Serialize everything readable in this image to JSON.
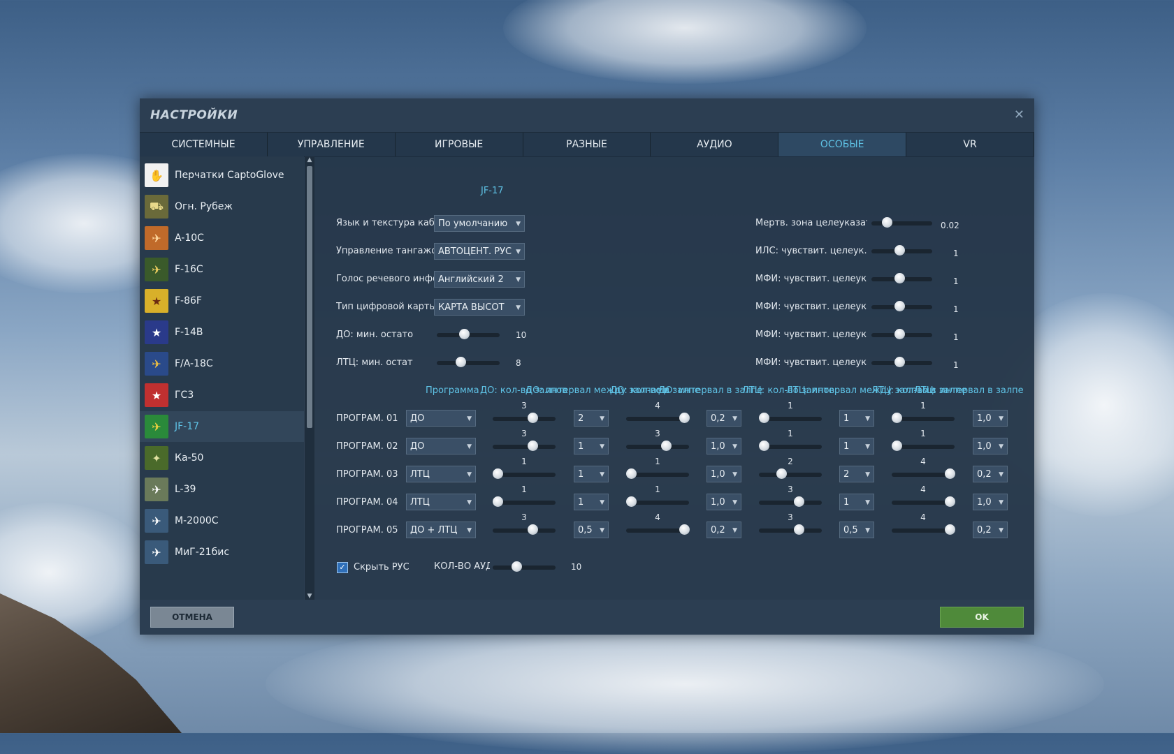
{
  "window": {
    "title": "НАСТРОЙКИ",
    "close_icon": "close-icon"
  },
  "tabs": [
    {
      "label": "СИСТЕМНЫЕ"
    },
    {
      "label": "УПРАВЛЕНИЕ"
    },
    {
      "label": "ИГРОВЫЕ"
    },
    {
      "label": "РАЗНЫЕ"
    },
    {
      "label": "АУДИО"
    },
    {
      "label": "ОСОБЫЕ",
      "active": true
    },
    {
      "label": "VR"
    }
  ],
  "sidebar": {
    "items": [
      {
        "label": "Перчатки CaptoGlove",
        "icon": "glove-icon"
      },
      {
        "label": "Огн. Рубеж",
        "icon": "tank-icon"
      },
      {
        "label": "A-10C",
        "icon": "a10-icon"
      },
      {
        "label": "F-16C",
        "icon": "f16-icon"
      },
      {
        "label": "F-86F",
        "icon": "f86-icon"
      },
      {
        "label": "F-14B",
        "icon": "f14-icon"
      },
      {
        "label": "F/A-18C",
        "icon": "fa18-icon"
      },
      {
        "label": "ГС3",
        "icon": "star-icon"
      },
      {
        "label": "JF-17",
        "icon": "jf17-icon",
        "active": true
      },
      {
        "label": "Ка-50",
        "icon": "ka50-icon"
      },
      {
        "label": "L-39",
        "icon": "l39-icon"
      },
      {
        "label": "M-2000C",
        "icon": "m2000-icon"
      },
      {
        "label": "МиГ-21бис",
        "icon": "mig21-icon"
      }
    ]
  },
  "content": {
    "section_title": "JF-17",
    "left_settings": [
      {
        "label": "Язык и текстура кабины",
        "value": "По умолчанию"
      },
      {
        "label": "Управление тангажом",
        "value": "АВТОЦЕНТ. РУС"
      },
      {
        "label": "Голос речевого информатора",
        "value": "Английский 2"
      },
      {
        "label": "Тип цифровой карты",
        "value": "КАРТА ВЫСОТ"
      }
    ],
    "left_sliders": [
      {
        "label": "ДО: мин. остато",
        "value": "10",
        "level": 0.42
      },
      {
        "label": "ЛТЦ: мин. остат",
        "value": "8",
        "level": 0.36
      }
    ],
    "right_sliders": [
      {
        "label": "Мертв. зона целеуказател",
        "value": "0.02",
        "level": 0.2
      },
      {
        "label": "ИЛС: чувствит. целеук. РЛ",
        "value": "1",
        "level": 0.45
      },
      {
        "label": "МФИ: чувствит. целеук. С",
        "value": "1",
        "level": 0.45
      },
      {
        "label": "МФИ: чувствит. целеук. Р",
        "value": "1",
        "level": 0.45
      },
      {
        "label": "МФИ: чувствит. целеук. W",
        "value": "1",
        "level": 0.45
      },
      {
        "label": "МФИ: чувствит. целеук. С",
        "value": "1",
        "level": 0.45
      }
    ],
    "table_headers": [
      "Программа",
      "ДО: кол-во залпов",
      "ДО: интервал между залпами",
      "ДО: кол-во в залпе",
      "ДО: интервал в залпе",
      "ЛТЦ: кол-во залпов",
      "ЛТЦ: интервал между залпами",
      "ЛТЦ: кол-во в залпе",
      "ЛТЦ: интервал в залпе"
    ],
    "programs": [
      {
        "label": "ПРОГРАМ. 01",
        "type": "ДО",
        "do_bursts": {
          "value": "3",
          "level": 0.66
        },
        "do_burst_interval": "2",
        "do_count": {
          "value": "4",
          "level": 1.0
        },
        "do_interval": "0,2",
        "ltc_bursts": {
          "value": "1",
          "level": 0.0
        },
        "ltc_burst_interval": "1",
        "ltc_count": {
          "value": "1",
          "level": 0.0
        },
        "ltc_interval": "1,0"
      },
      {
        "label": "ПРОГРАМ. 02",
        "type": "ДО",
        "do_bursts": {
          "value": "3",
          "level": 0.66
        },
        "do_burst_interval": "1",
        "do_count": {
          "value": "3",
          "level": 0.66
        },
        "do_interval": "1,0",
        "ltc_bursts": {
          "value": "1",
          "level": 0.0
        },
        "ltc_burst_interval": "1",
        "ltc_count": {
          "value": "1",
          "level": 0.0
        },
        "ltc_interval": "1,0"
      },
      {
        "label": "ПРОГРАМ. 03",
        "type": "ЛТЦ",
        "do_bursts": {
          "value": "1",
          "level": 0.0
        },
        "do_burst_interval": "1",
        "do_count": {
          "value": "1",
          "level": 0.0
        },
        "do_interval": "1,0",
        "ltc_bursts": {
          "value": "2",
          "level": 0.33
        },
        "ltc_burst_interval": "2",
        "ltc_count": {
          "value": "4",
          "level": 1.0
        },
        "ltc_interval": "0,2"
      },
      {
        "label": "ПРОГРАМ. 04",
        "type": "ЛТЦ",
        "do_bursts": {
          "value": "1",
          "level": 0.0
        },
        "do_burst_interval": "1",
        "do_count": {
          "value": "1",
          "level": 0.0
        },
        "do_interval": "1,0",
        "ltc_bursts": {
          "value": "3",
          "level": 0.66
        },
        "ltc_burst_interval": "1",
        "ltc_count": {
          "value": "4",
          "level": 1.0
        },
        "ltc_interval": "1,0"
      },
      {
        "label": "ПРОГРАМ. 05",
        "type": "ДО + ЛТЦ",
        "do_bursts": {
          "value": "3",
          "level": 0.66
        },
        "do_burst_interval": "0,5",
        "do_count": {
          "value": "4",
          "level": 1.0
        },
        "do_interval": "0,2",
        "ltc_bursts": {
          "value": "3",
          "level": 0.66
        },
        "ltc_burst_interval": "0,5",
        "ltc_count": {
          "value": "4",
          "level": 1.0
        },
        "ltc_interval": "0,2"
      }
    ],
    "hide_stick": {
      "label": "Скрыть РУС",
      "checked": true
    },
    "audio_count": {
      "label": "КОЛ-ВО АУДИ",
      "value": "10",
      "level": 0.35
    }
  },
  "footer": {
    "cancel_label": "ОТМЕНА",
    "ok_label": "OK"
  },
  "colors": {
    "accent": "#5fc3e6",
    "ok_button": "#4f8a3a",
    "cancel_button": "#7a8794"
  }
}
